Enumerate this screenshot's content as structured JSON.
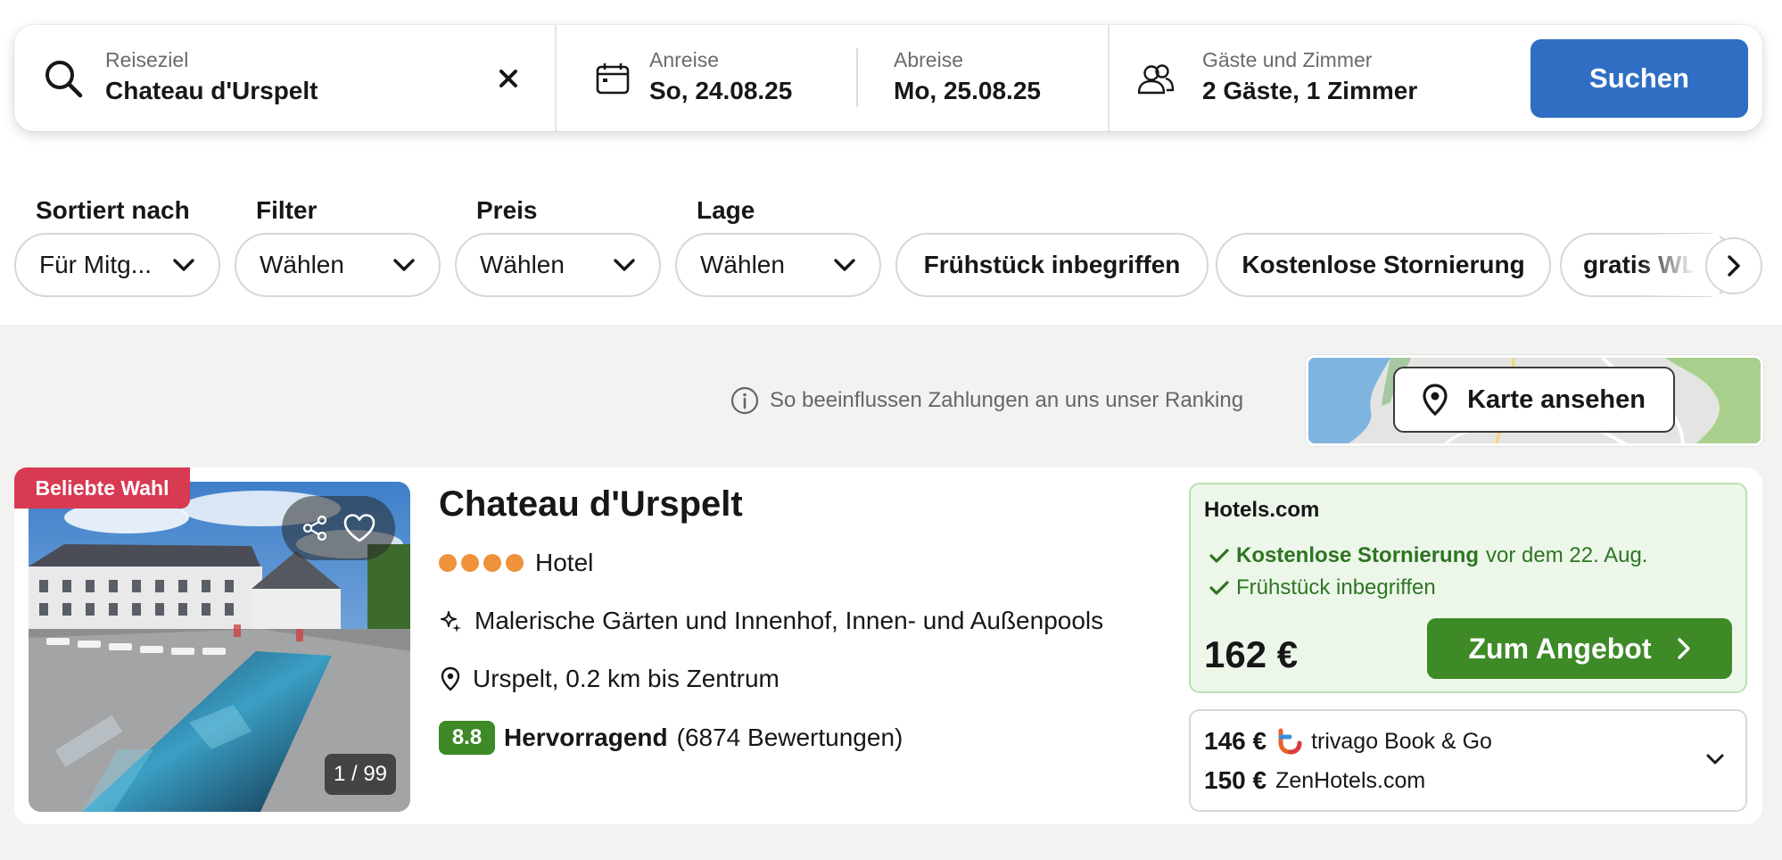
{
  "search": {
    "destination_label": "Reiseziel",
    "destination_value": "Chateau d'Urspelt",
    "checkin_label": "Anreise",
    "checkin_value": "So, 24.08.25",
    "checkout_label": "Abreise",
    "checkout_value": "Mo, 25.08.25",
    "guests_label": "Gäste und Zimmer",
    "guests_value": "2 Gäste, 1 Zimmer",
    "search_button": "Suchen"
  },
  "filters": {
    "sort_label": "Sortiert nach",
    "sort_value": "Für Mitg...",
    "filter_label": "Filter",
    "filter_value": "Wählen",
    "price_label": "Preis",
    "price_value": "Wählen",
    "location_label": "Lage",
    "location_value": "Wählen",
    "chips": [
      "Frühstück inbegriffen",
      "Kostenlose Stornierung",
      "gratis WLAN"
    ]
  },
  "ranking_info": "So beeinflussen Zahlungen an uns unser Ranking",
  "map_button": "Karte ansehen",
  "hotel": {
    "badge": "Beliebte Wahl",
    "photo_counter": "1 / 99",
    "name": "Chateau d'Urspelt",
    "stars": 4,
    "type": "Hotel",
    "feature": "Malerische Gärten und Innenhof, Innen- und Außenpools",
    "location": "Urspelt, 0.2 km bis Zentrum",
    "rating_score": "8.8",
    "rating_word": "Hervorragend",
    "rating_count": "(6874 Bewertungen)"
  },
  "offer": {
    "provider": "Hotels.com",
    "cancellation_bold": "Kostenlose Stornierung",
    "cancellation_rest": "vor dem 22. Aug.",
    "breakfast": "Frühstück inbegriffen",
    "price": "162 €",
    "deal_button": "Zum Angebot"
  },
  "alternatives": [
    {
      "price": "146 €",
      "provider": "trivago Book & Go"
    },
    {
      "price": "150 €",
      "provider": "ZenHotels.com"
    }
  ],
  "colors": {
    "primary_blue": "#2f6ec3",
    "deal_green": "#3d8a27",
    "badge_red": "#d83a52",
    "star_orange": "#f0913b"
  }
}
